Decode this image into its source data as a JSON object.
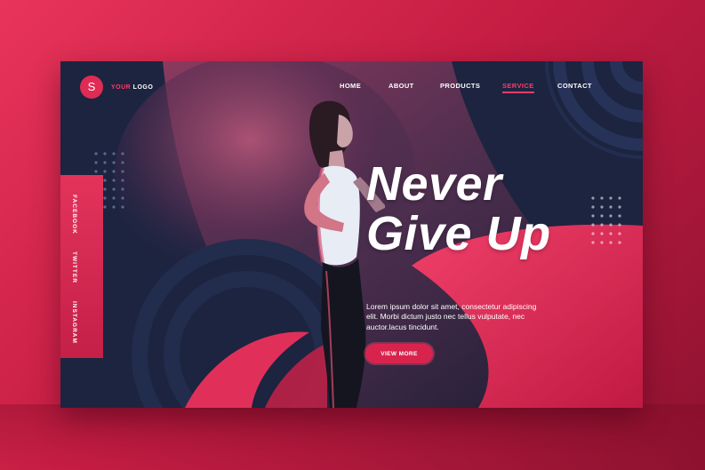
{
  "logo": {
    "badge": "S",
    "accent_text": "YOUR",
    "light_text": " LOGO"
  },
  "nav": {
    "items": [
      "HOME",
      "ABOUT",
      "PRODUCTS",
      "SERVICE",
      "CONTACT"
    ],
    "active": "SERVICE"
  },
  "social": {
    "items": [
      "FACEBOOK",
      "TWITTER",
      "INSTAGRAM"
    ]
  },
  "hero": {
    "headline_line1": "Never",
    "headline_line2": "Give Up",
    "body": "Lorem ipsum dolor sit amet, consectetur adipiscing elit. Morbi dictum justo nec tellus vulputate, nec auctor.lacus tincidunt.",
    "cta_label": "VIEW MORE"
  },
  "colors": {
    "accent": "#e02b55",
    "accent_light": "#ff3b66",
    "navy": "#1c2440",
    "navy_light": "#2a3558",
    "white": "#ffffff"
  },
  "icons": [
    "logo-badge-icon",
    "dot-grid-icon",
    "runner-photo"
  ]
}
